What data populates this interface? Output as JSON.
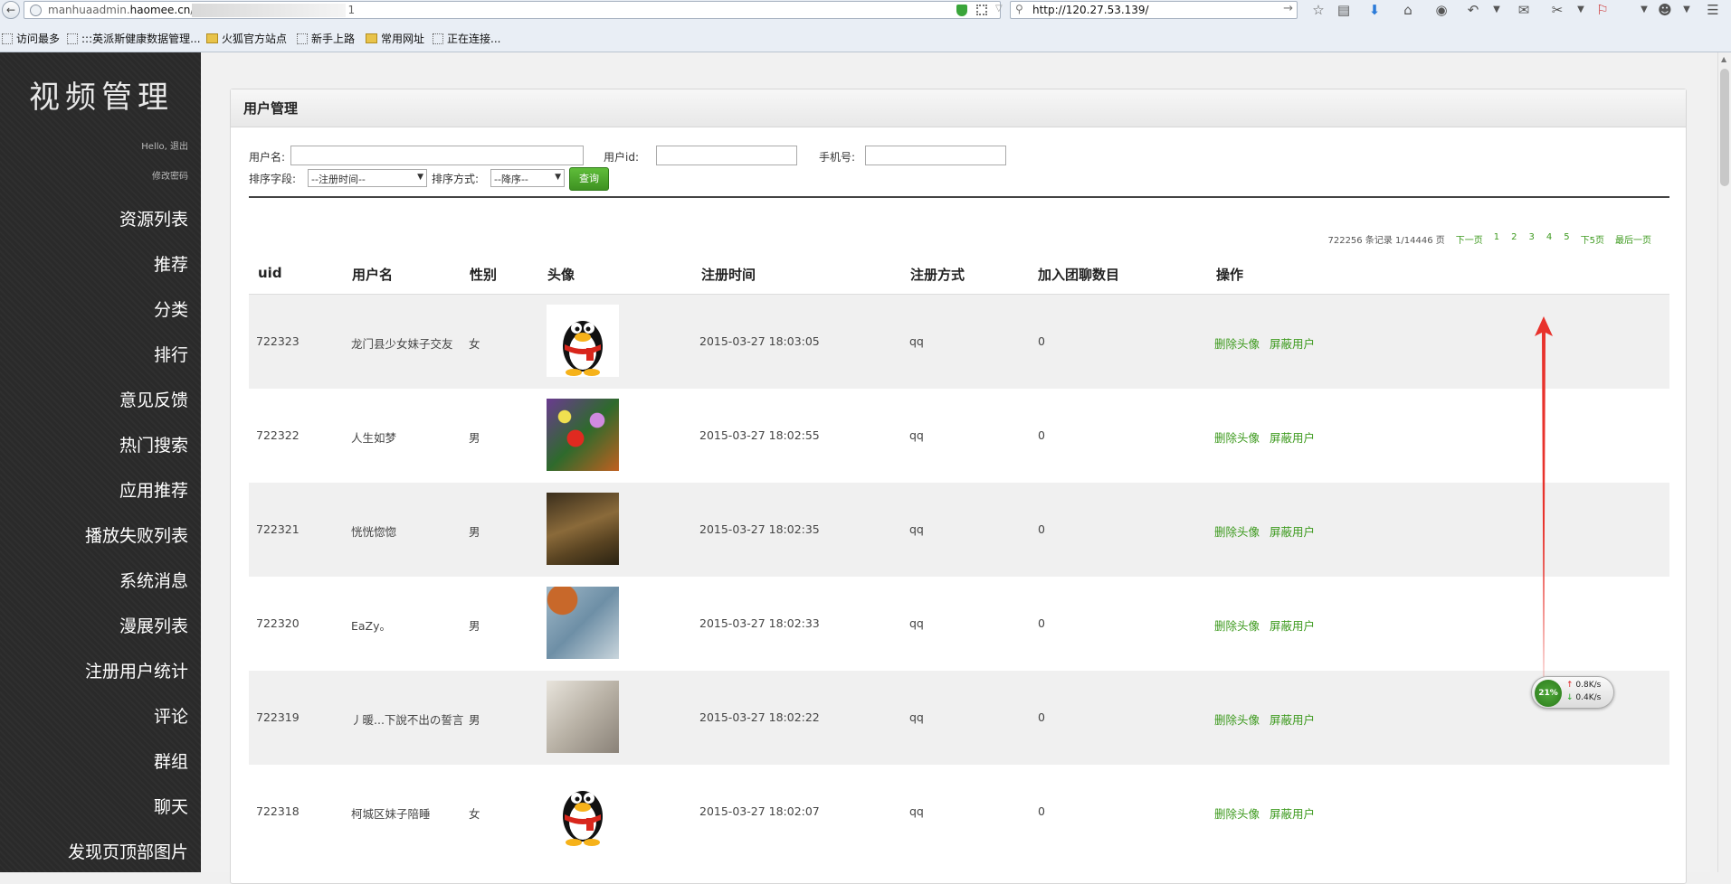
{
  "browser": {
    "url_host_prefix": "manhuaadmin.",
    "url_host": "haomee.cn",
    "url_path": "/",
    "url_suffix": "1",
    "search_text": "http://120.27.53.139/",
    "bookmarks": [
      "访问最多",
      ":::英派斯健康数据管理...",
      "火狐官方站点",
      "新手上路",
      "常用网址",
      "正在连接..."
    ]
  },
  "sidebar": {
    "title": "视频管理",
    "hello": "Hello, 退出",
    "change_password": "修改密码",
    "items": [
      "资源列表",
      "推荐",
      "分类",
      "排行",
      "意见反馈",
      "热门搜索",
      "应用推荐",
      "播放失败列表",
      "系统消息",
      "漫展列表",
      "注册用户统计",
      "评论",
      "群组",
      "聊天",
      "发现页顶部图片"
    ]
  },
  "panel": {
    "title": "用户管理"
  },
  "filters": {
    "username_label": "用户名:",
    "userid_label": "用户id:",
    "phone_label": "手机号:",
    "sort_field_label": "排序字段:",
    "sort_field_value": "--注册时间--",
    "sort_order_label": "排序方式:",
    "sort_order_value": "--降序--",
    "query_button": "查询"
  },
  "pager": {
    "summary": "722256 条记录 1/14446 页",
    "next": "下一页",
    "pages": [
      "1",
      "2",
      "3",
      "4",
      "5"
    ],
    "next5": "下5页",
    "last": "最后一页"
  },
  "table": {
    "headers": [
      "uid",
      "用户名",
      "性别",
      "头像",
      "注册时间",
      "注册方式",
      "加入团聊数目",
      "操作"
    ],
    "rows": [
      {
        "uid": "722323",
        "name": "龙门县少女妹子交友",
        "gender": "女",
        "avatar": "penguin",
        "time": "2015-03-27 18:03:05",
        "method": "qq",
        "groups": "0"
      },
      {
        "uid": "722322",
        "name": "人生如梦",
        "gender": "男",
        "avatar": "flowers",
        "time": "2015-03-27 18:02:55",
        "method": "qq",
        "groups": "0"
      },
      {
        "uid": "722321",
        "name": "恍恍惚惚",
        "gender": "男",
        "avatar": "grass",
        "time": "2015-03-27 18:02:35",
        "method": "qq",
        "groups": "0"
      },
      {
        "uid": "722320",
        "name": "EaZy。",
        "gender": "男",
        "avatar": "texture",
        "time": "2015-03-27 18:02:33",
        "method": "qq",
        "groups": "0"
      },
      {
        "uid": "722319",
        "name": "丿暖...下說不出の誓言",
        "gender": "男",
        "avatar": "person",
        "time": "2015-03-27 18:02:22",
        "method": "qq",
        "groups": "0"
      },
      {
        "uid": "722318",
        "name": "柯城区妹子陪睡",
        "gender": "女",
        "avatar": "penguin",
        "time": "2015-03-27 18:02:07",
        "method": "qq",
        "groups": "0"
      }
    ],
    "op_delete_avatar": "删除头像",
    "op_block_user": "屏蔽用户"
  },
  "net_widget": {
    "cpu": "21%",
    "up": "0.8K/s",
    "down": "0.4K/s"
  },
  "colors": {
    "accent": "#3d9a1e",
    "sidebar_bg": "#2a2a2a",
    "arrow": "#e8322c"
  }
}
